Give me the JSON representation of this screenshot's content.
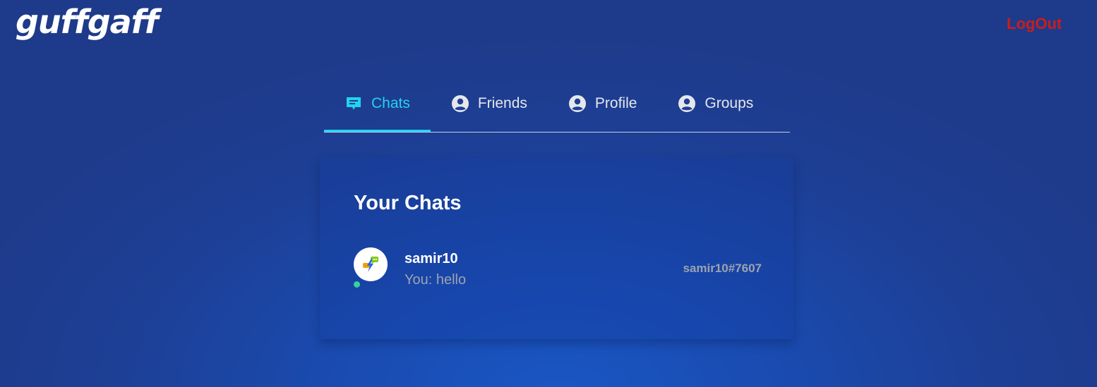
{
  "app": {
    "logo": "guffgaff",
    "logout_label": "LogOut"
  },
  "tabs": [
    {
      "label": "Chats",
      "icon": "chat-icon",
      "active": true
    },
    {
      "label": "Friends",
      "icon": "user-circle-icon",
      "active": false
    },
    {
      "label": "Profile",
      "icon": "user-circle-icon",
      "active": false
    },
    {
      "label": "Groups",
      "icon": "user-circle-icon",
      "active": false
    }
  ],
  "chats": {
    "title": "Your Chats",
    "items": [
      {
        "name": "samir10",
        "preview": "You: hello",
        "tag": "samir10#7607",
        "online": true
      }
    ]
  },
  "colors": {
    "accent": "#22d3ee",
    "logout": "#c81e1e",
    "online": "#34d399",
    "muted_text": "#9ca3af"
  }
}
